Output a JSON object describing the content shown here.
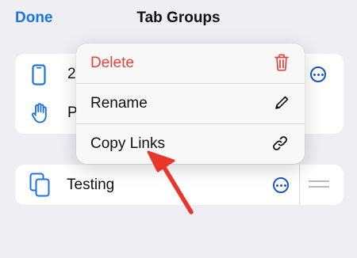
{
  "header": {
    "done_label": "Done",
    "title": "Tab Groups"
  },
  "groups": [
    {
      "label": "2",
      "icon": "phone-icon"
    },
    {
      "label": "P",
      "icon": "hand-icon"
    }
  ],
  "testing_group": {
    "label": "Testing",
    "icon": "tabs-icon"
  },
  "context_menu": {
    "items": [
      {
        "label": "Delete",
        "icon": "trash-icon",
        "destructive": true
      },
      {
        "label": "Rename",
        "icon": "pencil-icon"
      },
      {
        "label": "Copy Links",
        "icon": "link-icon"
      }
    ]
  },
  "colors": {
    "accent": "#1a73e8",
    "destructive": "#e5443a",
    "annotation": "#e8362c",
    "background": "#eeeef3"
  }
}
